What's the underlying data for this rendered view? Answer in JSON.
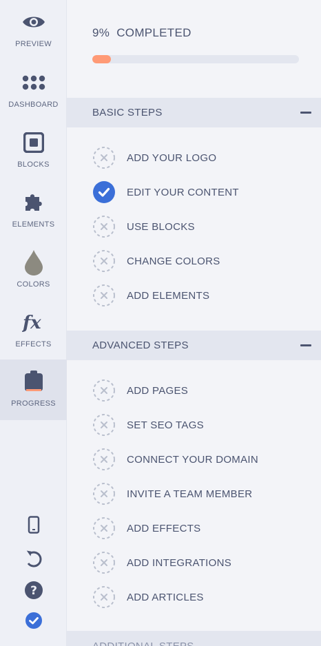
{
  "sidebar": {
    "items": [
      {
        "label": "PREVIEW",
        "icon": "eye-icon"
      },
      {
        "label": "DASHBOARD",
        "icon": "dots-grid-icon"
      },
      {
        "label": "BLOCKS",
        "icon": "blocks-square-icon"
      },
      {
        "label": "ELEMENTS",
        "icon": "puzzle-icon"
      },
      {
        "label": "COLORS",
        "icon": "droplet-icon"
      },
      {
        "label": "EFFECTS",
        "icon": "fx-icon"
      },
      {
        "label": "PROGRESS",
        "icon": "clipboard-progress-icon",
        "active": true
      }
    ],
    "bottom_icons": [
      "mobile-icon",
      "undo-icon",
      "help-icon",
      "check-circle-icon"
    ]
  },
  "progress": {
    "label": "9%  COMPLETED",
    "percent": 9,
    "fill_color": "#ff9a76"
  },
  "sections": {
    "basic": {
      "title": "BASIC STEPS",
      "steps": [
        {
          "label": "ADD YOUR LOGO",
          "done": false
        },
        {
          "label": "EDIT YOUR CONTENT",
          "done": true
        },
        {
          "label": "USE BLOCKS",
          "done": false
        },
        {
          "label": "CHANGE COLORS",
          "done": false
        },
        {
          "label": "ADD ELEMENTS",
          "done": false
        }
      ]
    },
    "advanced": {
      "title": "ADVANCED STEPS",
      "steps": [
        {
          "label": "ADD PAGES",
          "done": false
        },
        {
          "label": "SET SEO TAGS",
          "done": false
        },
        {
          "label": "CONNECT YOUR DOMAIN",
          "done": false
        },
        {
          "label": "INVITE A TEAM MEMBER",
          "done": false
        },
        {
          "label": "ADD EFFECTS",
          "done": false
        },
        {
          "label": "ADD INTEGRATIONS",
          "done": false
        },
        {
          "label": "ADD ARTICLES",
          "done": false
        }
      ]
    },
    "additional": {
      "title": "ADDITIONAL STEPS"
    }
  },
  "colors": {
    "accent": "#3b6fd8",
    "text": "#4b5470",
    "pending_circle": "#b9bfcd",
    "progress_fill": "#ff9a76"
  }
}
